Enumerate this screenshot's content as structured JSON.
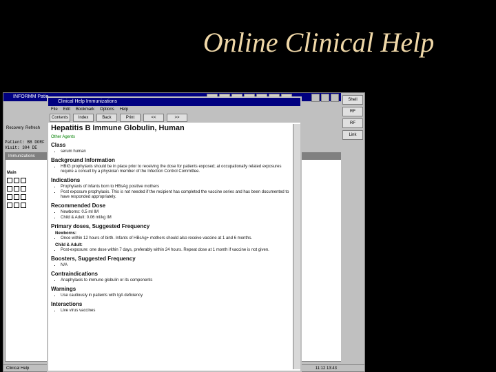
{
  "slide_title": "Online Clinical Help",
  "app": {
    "title": "INFORMM Patie",
    "toolbar": [
      {
        "label": "Recovery"
      },
      {
        "label": "Refresh"
      }
    ],
    "patient_lines": [
      "Patient:  BB DORF",
      "Visit:    304 DE"
    ],
    "imm_title": "Immunizations",
    "status": "Clinical Help",
    "status_right": "11:12 13:43",
    "side_label": "Main",
    "side_buttons": [
      "Shell",
      "RF",
      "RF",
      "Link"
    ]
  },
  "help": {
    "title": "Clinical Help Immunizations",
    "menu": [
      "File",
      "Edit",
      "Bookmark",
      "Options",
      "Help"
    ],
    "buttons": [
      "Contents",
      "Index",
      "Back",
      "Print",
      "<<",
      ">>"
    ],
    "heading": "Hepatitis B Immune Globulin, Human",
    "other_agents": "Other Agents",
    "sections": [
      {
        "title": "Class",
        "items": [
          "serum human"
        ]
      },
      {
        "title": "Background Information",
        "items": [
          "HBIG prophylaxis should be in place prior to receiving the dose for patients exposed; at occupationally related exposures require a consult by a physician member of the Infection Control Committee."
        ]
      },
      {
        "title": "Indications",
        "items": [
          "Prophylaxis of infants born to HBsAg positive mothers",
          "Post exposure prophylaxis. This is not needed if the recipient has completed the vaccine series and has been documented to have responded appropriately."
        ]
      },
      {
        "title": "Recommended Dose",
        "items": [
          "Newborns: 0.5 ml IM",
          "Child & Adult: 0.06 ml/kg IM"
        ]
      },
      {
        "title": "Primary doses, Suggested Frequency",
        "sub": [
          {
            "label": "Newborns:",
            "items": [
              "Once within 12 hours of birth. Infants of HBsAg+ mothers should also receive vaccine at 1 and 6 months."
            ]
          },
          {
            "label": "Child & Adult:",
            "items": [
              "Post-exposure: one dose within 7 days, preferably within 24 hours. Repeat dose at 1 month if vaccine is not given."
            ]
          }
        ]
      },
      {
        "title": "Boosters, Suggested Frequency",
        "items": [
          "N/A"
        ]
      },
      {
        "title": "Contraindications",
        "items": [
          "Anaphylaxis to immune globulin or its components"
        ]
      },
      {
        "title": "Warnings",
        "items": [
          "Use cautiously in patients with IgA deficiency"
        ]
      },
      {
        "title": "Interactions",
        "items": [
          "Live virus vaccines"
        ]
      }
    ]
  }
}
